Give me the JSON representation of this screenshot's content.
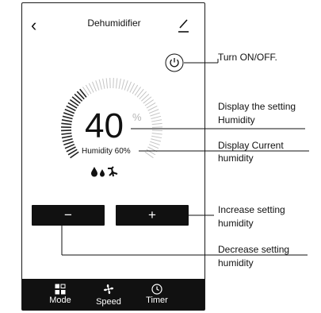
{
  "app": {
    "title": "Dehumidifier",
    "back_icon": "chevron-left-icon",
    "edit_icon": "pencil-icon",
    "power_icon": "power-icon"
  },
  "humidity": {
    "setting_value": "40",
    "setting_unit": "%",
    "current_label": "Humidity 60%"
  },
  "controls": {
    "decrease_label": "−",
    "increase_label": "+"
  },
  "bottom_bar": {
    "items": [
      {
        "label": "Mode",
        "icon": "mode-icon"
      },
      {
        "label": "Speed",
        "icon": "fan-icon"
      },
      {
        "label": "Timer",
        "icon": "clock-icon"
      }
    ]
  },
  "annotations": {
    "power": "Turn ON/OFF.",
    "setting_humidity_line1": "Display the setting",
    "setting_humidity_line2": "Humidity",
    "current_humidity_line1": "Display Current",
    "current_humidity_line2": "humidity",
    "increase_line1": "Increase setting",
    "increase_line2": "humidity",
    "decrease_line1": "Decrease setting",
    "decrease_line2": "humidity"
  },
  "colors": {
    "foreground": "#111111",
    "dial_tick_active": "#222222",
    "dial_tick_inactive": "#c4c4c4",
    "percent_grey": "#b5b5b5"
  }
}
